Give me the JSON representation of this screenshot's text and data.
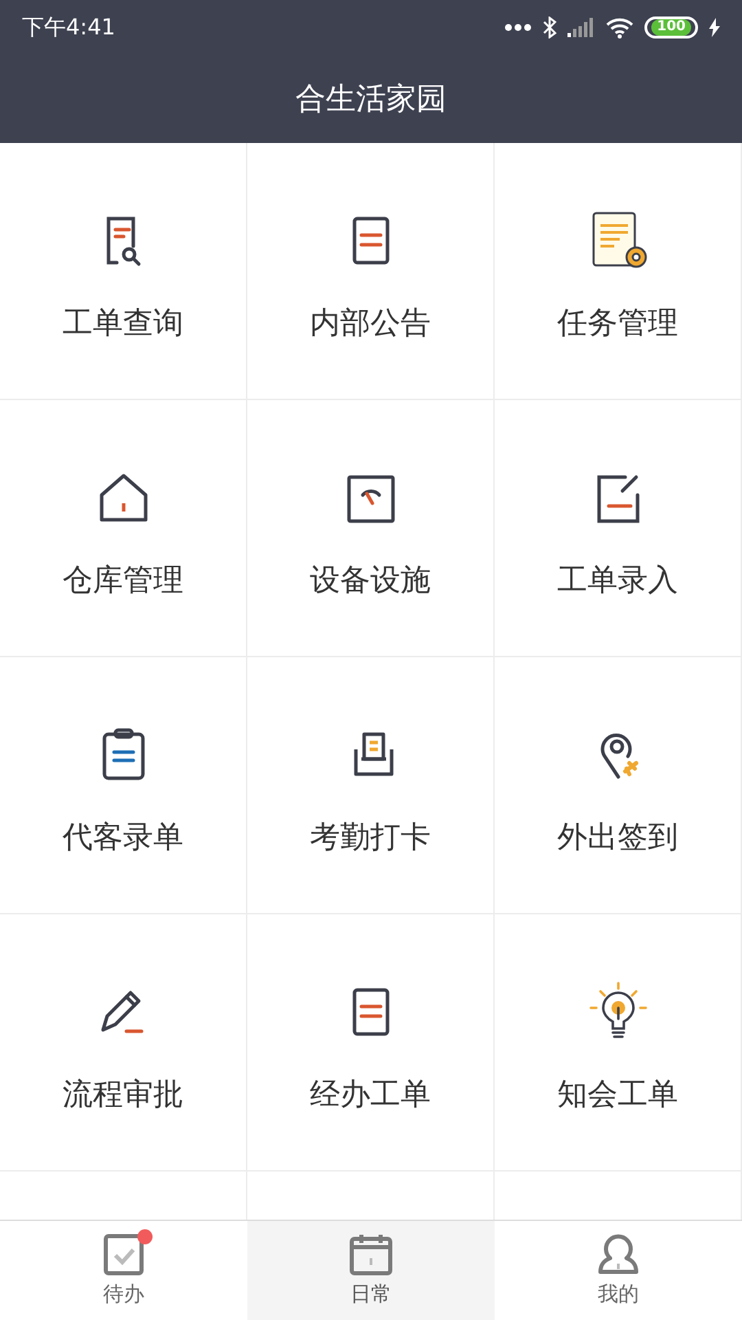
{
  "status_bar": {
    "time": "下午4:41",
    "battery": "100"
  },
  "header": {
    "title": "合生活家园"
  },
  "grid": [
    {
      "label": "工单查询"
    },
    {
      "label": "内部公告"
    },
    {
      "label": "任务管理"
    },
    {
      "label": "仓库管理"
    },
    {
      "label": "设备设施"
    },
    {
      "label": "工单录入"
    },
    {
      "label": "代客录单"
    },
    {
      "label": "考勤打卡"
    },
    {
      "label": "外出签到"
    },
    {
      "label": "流程审批"
    },
    {
      "label": "经办工单"
    },
    {
      "label": "知会工单"
    }
  ],
  "tab_bar": [
    {
      "label": "待办",
      "selected": false,
      "badge": true
    },
    {
      "label": "日常",
      "selected": true,
      "badge": false
    },
    {
      "label": "我的",
      "selected": false,
      "badge": false
    }
  ]
}
